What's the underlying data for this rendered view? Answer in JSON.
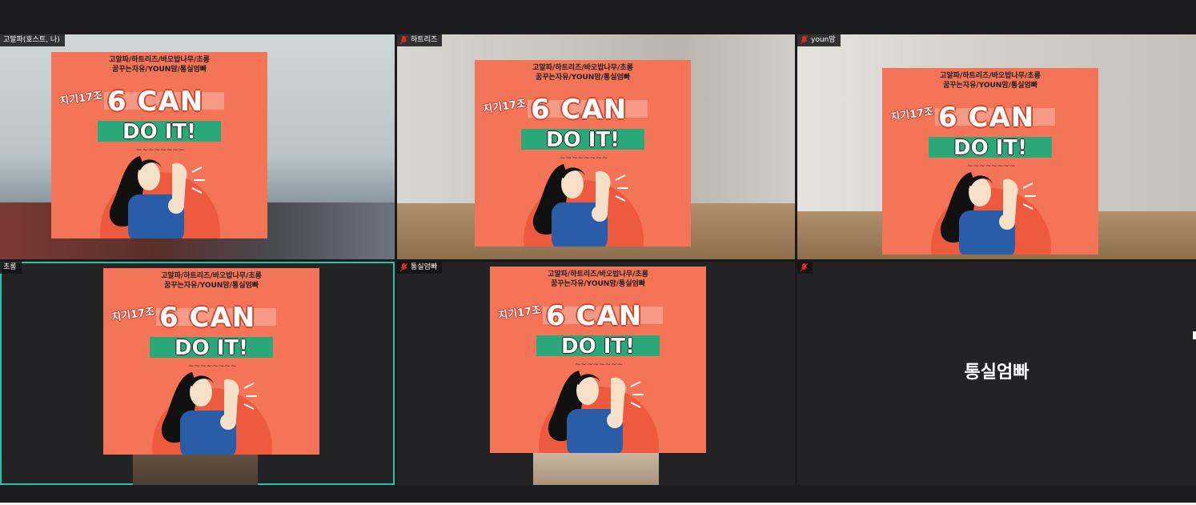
{
  "meeting": {
    "poster": {
      "line1": "고말파/하트리즈/바오밥나무/초롱",
      "line2": "꿈꾸는자유/YOUN맘/통실엄빠",
      "group": "지기17조",
      "title_can": "6 CAN",
      "title_doit": "DO IT!",
      "squiggle": "~~~~~~~~"
    },
    "participants": [
      {
        "name": "고말파(호스트, 나)",
        "active": true
      },
      {
        "name": "하트리즈",
        "active": false
      },
      {
        "name": "youn맘",
        "active": false
      },
      {
        "name": "초롱",
        "active": true
      },
      {
        "name": "통실엄빠",
        "active": false
      },
      {
        "name": "",
        "active": false,
        "avatar_name": "통실엄빠"
      }
    ]
  },
  "colors": {
    "poster_bg": "#f47458",
    "poster_green": "#2aa87a",
    "active_border": "#23c5a8",
    "tile_bg": "#232326"
  },
  "icons": {
    "muted_mic": "mic-muted-icon"
  }
}
